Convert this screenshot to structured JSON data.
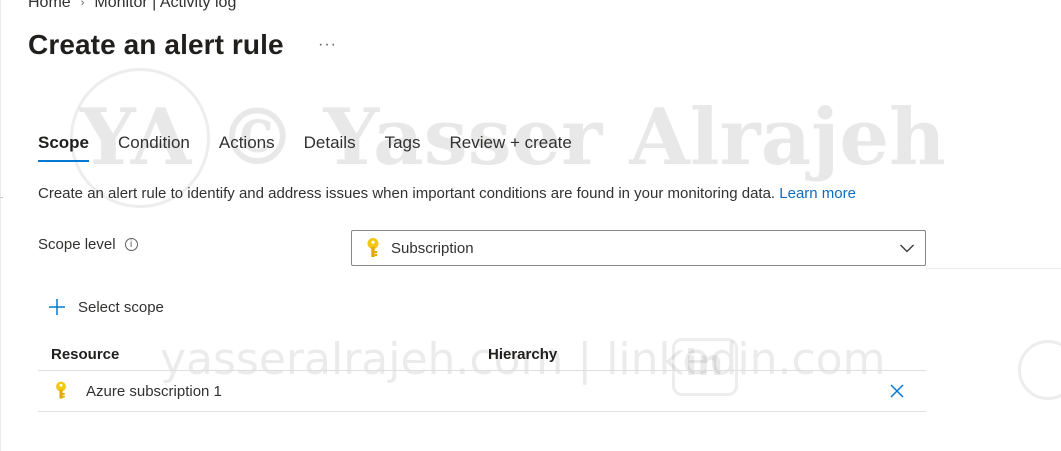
{
  "breadcrumb": {
    "home": "Home",
    "separator": "›",
    "current": "Monitor | Activity log"
  },
  "page": {
    "title": "Create an alert rule",
    "more": "···"
  },
  "tabs": [
    {
      "label": "Scope",
      "active": true
    },
    {
      "label": "Condition",
      "active": false
    },
    {
      "label": "Actions",
      "active": false
    },
    {
      "label": "Details",
      "active": false
    },
    {
      "label": "Tags",
      "active": false
    },
    {
      "label": "Review + create",
      "active": false
    }
  ],
  "description": {
    "text": "Create an alert rule to identify and address issues when important conditions are found in your monitoring data. ",
    "link": "Learn more"
  },
  "scope_level": {
    "label": "Scope level",
    "info_icon": "info-icon",
    "info_glyph": "i",
    "value": "Subscription",
    "icon": "key-icon"
  },
  "select_scope": {
    "label": "Select scope",
    "icon": "plus-icon"
  },
  "table": {
    "headers": {
      "resource": "Resource",
      "hierarchy": "Hierarchy"
    },
    "rows": [
      {
        "resource": "Azure subscription 1",
        "hierarchy": "",
        "icon": "key-icon"
      }
    ]
  },
  "watermark": {
    "main": "YA © Yasser Alrajeh",
    "site": "yasseralrajeh.com  |       linkedin.com",
    "in_glyph": "in"
  },
  "colors": {
    "accent": "#0078d4",
    "link": "#0f6cbd",
    "key": "#f2c811"
  }
}
